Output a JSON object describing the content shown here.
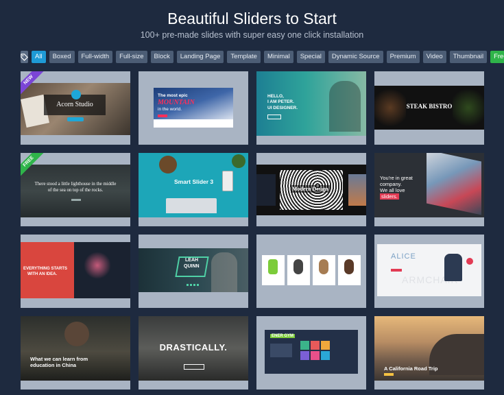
{
  "header": {
    "title": "Beautiful Sliders to Start",
    "subtitle": "100+ pre-made slides with super easy one click installation"
  },
  "filters": {
    "tag_icon": "tag-icon",
    "items": [
      "All",
      "Boxed",
      "Full-width",
      "Full-size",
      "Block",
      "Landing Page",
      "Template",
      "Minimal",
      "Special",
      "Dynamic Source",
      "Premium",
      "Video",
      "Thumbnail",
      "Free"
    ],
    "active": "All",
    "colors": {
      "active": "#1e9ad6",
      "free": "#2fb44a",
      "default": "#4c5d75"
    }
  },
  "cards": {
    "acorn": {
      "title": "Acorn Studio",
      "ribbon": "NEW"
    },
    "mountain": {
      "line1": "The most epic",
      "line2": "MOUNTAIN",
      "line3": "in the world."
    },
    "peter": {
      "line1": "HELLO,",
      "line2": "I AM PETER.",
      "line3": "UI DESIGNER."
    },
    "steak": {
      "title": "STEAK BISTRO"
    },
    "lighthouse": {
      "line1": "There stood a little lighthouse in the middle",
      "line2": "of the sea on top of the rocks.",
      "ribbon": "FREE"
    },
    "smartslider": {
      "title": "Smart Slider 3"
    },
    "modern": {
      "title": "Modern Design"
    },
    "company": {
      "line1": "You're in great",
      "line2": "company.",
      "line3": "We all love",
      "highlight": "sliders."
    },
    "everything": {
      "line1": "EVERYTHING STARTS",
      "line2": "WITH AN IDEA."
    },
    "leah": {
      "line1": "LEAH",
      "line2": "QUINN"
    },
    "alice": {
      "title": "ALICE",
      "watermark": "ARMCHAIR"
    },
    "education": {
      "line1": "What we can learn from",
      "line2": "education in China"
    },
    "drastically": {
      "title": "DRASTICALLY."
    },
    "enegym": {
      "title": "ENER GYM"
    },
    "roadtrip": {
      "title": "A California Road Trip"
    }
  }
}
